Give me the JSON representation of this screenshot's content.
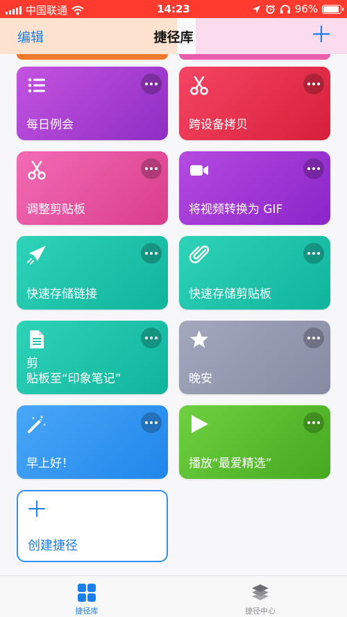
{
  "status_bar": {
    "carrier": "中国联通",
    "time": "14:23",
    "battery": "96%",
    "battery_level": 0.96,
    "icons": [
      "signal-icon",
      "wifi-icon",
      "location-icon",
      "alarm-icon",
      "headphones-icon",
      "battery-icon"
    ]
  },
  "nav": {
    "edit_label": "编辑",
    "title": "捷径库",
    "add_icon": "plus-icon"
  },
  "shortcuts": [
    {
      "label": "每日例会",
      "icon": "list-icon",
      "colors": [
        "#c454e0",
        "#8f2dc4"
      ]
    },
    {
      "label": "跨设备拷贝",
      "icon": "scissors-icon",
      "colors": [
        "#f44564",
        "#d71f3a"
      ]
    },
    {
      "label": "调整剪贴板",
      "icon": "scissors-icon",
      "colors": [
        "#f36bb4",
        "#d93d8c"
      ]
    },
    {
      "label": "将视频转换为 GIF",
      "icon": "video-camera-icon",
      "colors": [
        "#b54ae0",
        "#8b25c9"
      ]
    },
    {
      "label": "快速存储链接",
      "icon": "paper-plane-icon",
      "colors": [
        "#2fd3b8",
        "#10b39c"
      ]
    },
    {
      "label": "快速存储剪贴板",
      "icon": "paperclip-icon",
      "colors": [
        "#2fd3b8",
        "#10b39c"
      ]
    },
    {
      "label": "剪\n贴板至“印象笔记”",
      "icon": "document-icon",
      "colors": [
        "#2fd3b8",
        "#10b39c"
      ]
    },
    {
      "label": "晚安",
      "icon": "star-icon",
      "colors": [
        "#a3a8bd",
        "#868ba3"
      ]
    },
    {
      "label": "早上好！",
      "icon": "magic-wand-icon",
      "colors": [
        "#4aa7f7",
        "#1f86ea"
      ]
    },
    {
      "label": "播放“最爱精选”",
      "icon": "play-icon",
      "colors": [
        "#6fd141",
        "#45a81e"
      ]
    }
  ],
  "create": {
    "label": "创建捷径",
    "icon": "plus-icon"
  },
  "tabs": [
    {
      "label": "捷径库",
      "icon": "grid-icon",
      "active": true
    },
    {
      "label": "捷径中心",
      "icon": "layers-icon",
      "active": false
    }
  ],
  "colors": {
    "accent": "#1a7fe8",
    "status_bar": "#ff3b30"
  }
}
